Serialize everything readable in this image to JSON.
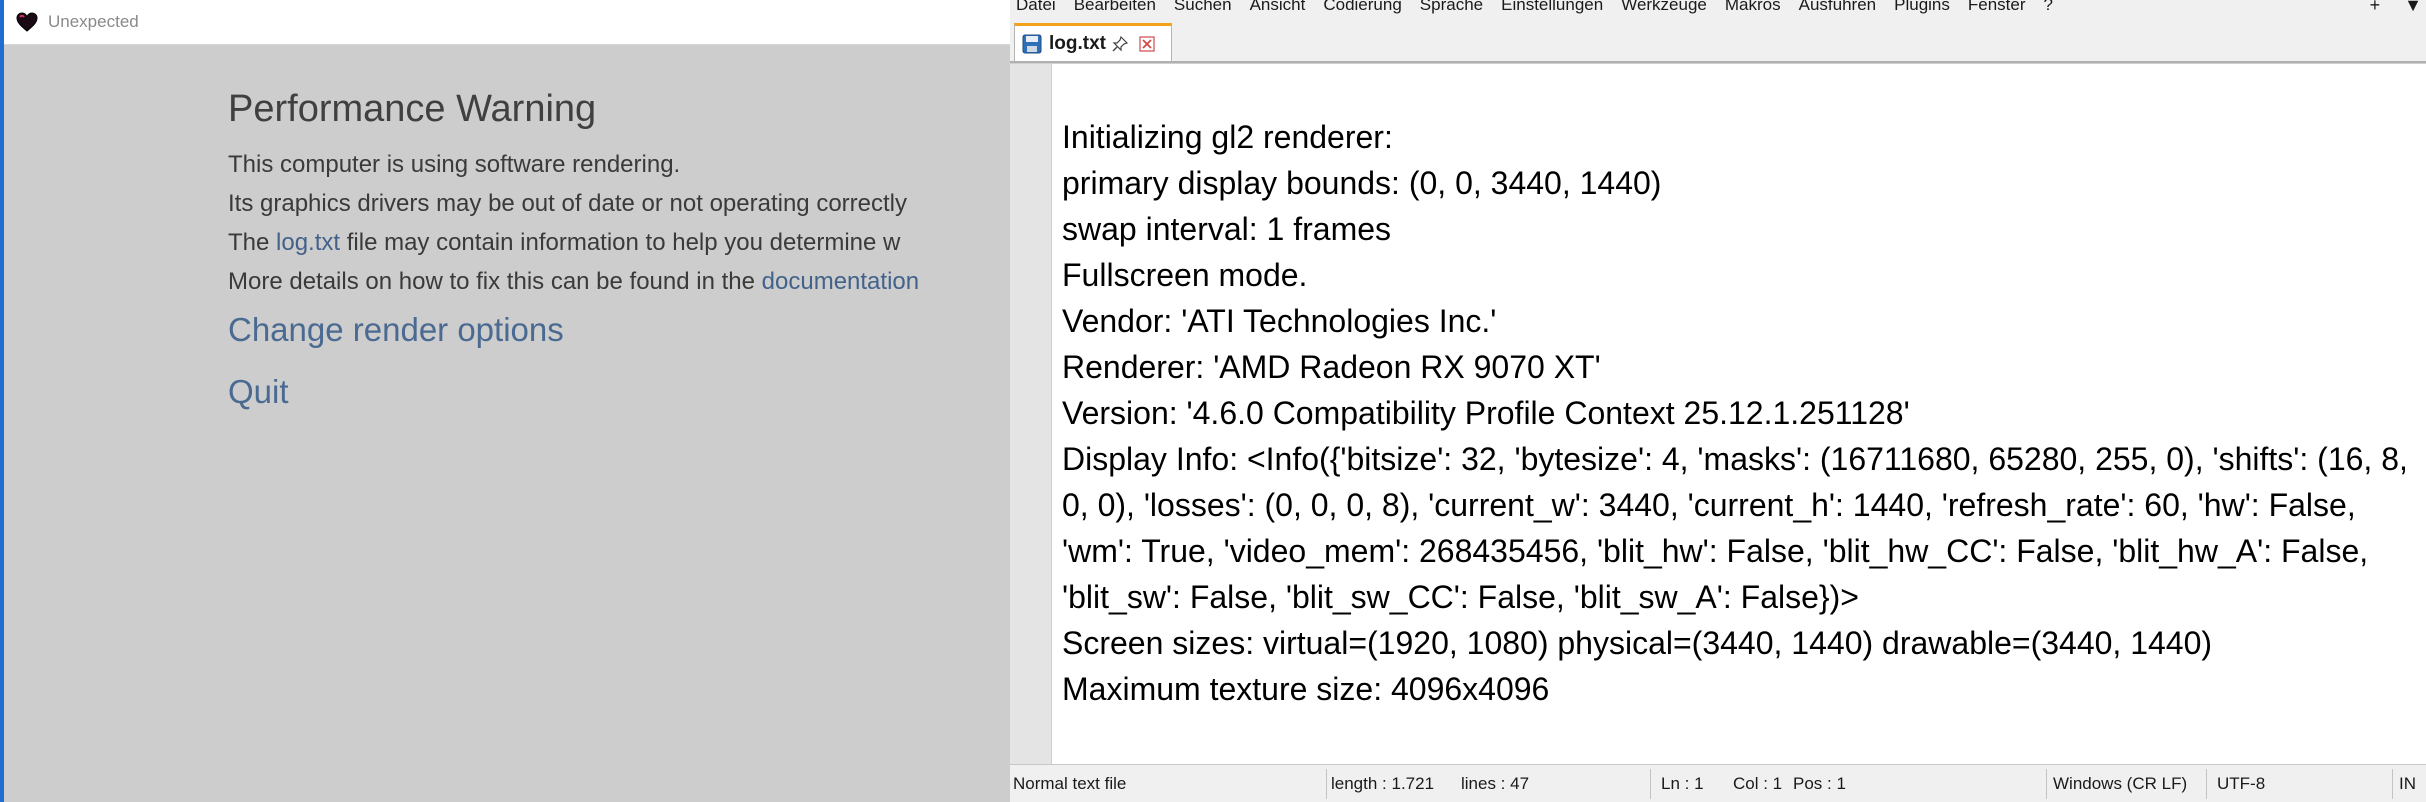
{
  "left_window": {
    "title": "Unexpected",
    "heading": "Performance Warning",
    "line1": "This computer is using software rendering.",
    "line2": "Its graphics drivers may be out of date or not operating correctly",
    "line3_prefix": "The ",
    "line3_link": "log.txt",
    "line3_suffix": " file may contain information to help you determine w",
    "line4_prefix": "More details on how to fix this can be found in the ",
    "line4_link": "documentation",
    "change_render_options": "Change render options",
    "quit": "Quit"
  },
  "notepad": {
    "menu": [
      "Datei",
      "Bearbeiten",
      "Suchen",
      "Ansicht",
      "Codierung",
      "Sprache",
      "Einstellungen",
      "Werkzeuge",
      "Makros",
      "Ausführen",
      "Plugins",
      "Fenster",
      "?"
    ],
    "menu_right_plus": "+",
    "menu_right_arrow": "▼",
    "tab_label": "log.txt",
    "lines": [
      "Initializing gl2 renderer:",
      "primary display bounds: (0, 0, 3440, 1440)",
      "swap interval: 1 frames",
      "Fullscreen mode.",
      "Vendor: 'ATI Technologies Inc.'",
      "Renderer: 'AMD Radeon RX 9070 XT'",
      "Version: '4.6.0 Compatibility Profile Context 25.12.1.251128'",
      "Display Info: <Info({'bitsize': 32, 'bytesize': 4, 'masks': (16711680, 65280, 255, 0), 'shifts': (16, 8, 0, 0), 'losses': (0, 0, 0, 8), 'current_w': 3440, 'current_h': 1440, 'refresh_rate': 60, 'hw': False, 'wm': True, 'video_mem': 268435456, 'blit_hw': False, 'blit_hw_CC': False, 'blit_hw_A': False, 'blit_sw': False, 'blit_sw_CC': False, 'blit_sw_A': False})>",
      "Screen sizes: virtual=(1920, 1080) physical=(3440, 1440) drawable=(3440, 1440)",
      "Maximum texture size: 4096x4096"
    ],
    "status": {
      "file_type": "Normal text file",
      "length": "length : 1.721",
      "lines": "lines : 47",
      "ln": "Ln : 1",
      "col": "Col : 1",
      "pos": "Pos : 1",
      "eol": "Windows (CR LF)",
      "encoding": "UTF-8",
      "mode": "IN"
    }
  }
}
